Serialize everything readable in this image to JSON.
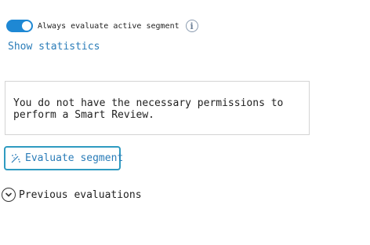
{
  "toggle": {
    "label": "Always evaluate active segment",
    "state": "on",
    "color": "#1e88d4",
    "info_icon": "info-icon",
    "info_glyph": "i"
  },
  "stats_link": {
    "label": "Show statistics"
  },
  "permission_notice": {
    "text": "You do not have the necessary permissions to perform a Smart Review."
  },
  "evaluate_button": {
    "icon": "magic-wand-icon",
    "label": "Evaluate segment",
    "border_color": "#2f9bc1"
  },
  "previous_evaluations": {
    "icon": "chevron-down-circle-icon",
    "label": "Previous evaluations"
  }
}
